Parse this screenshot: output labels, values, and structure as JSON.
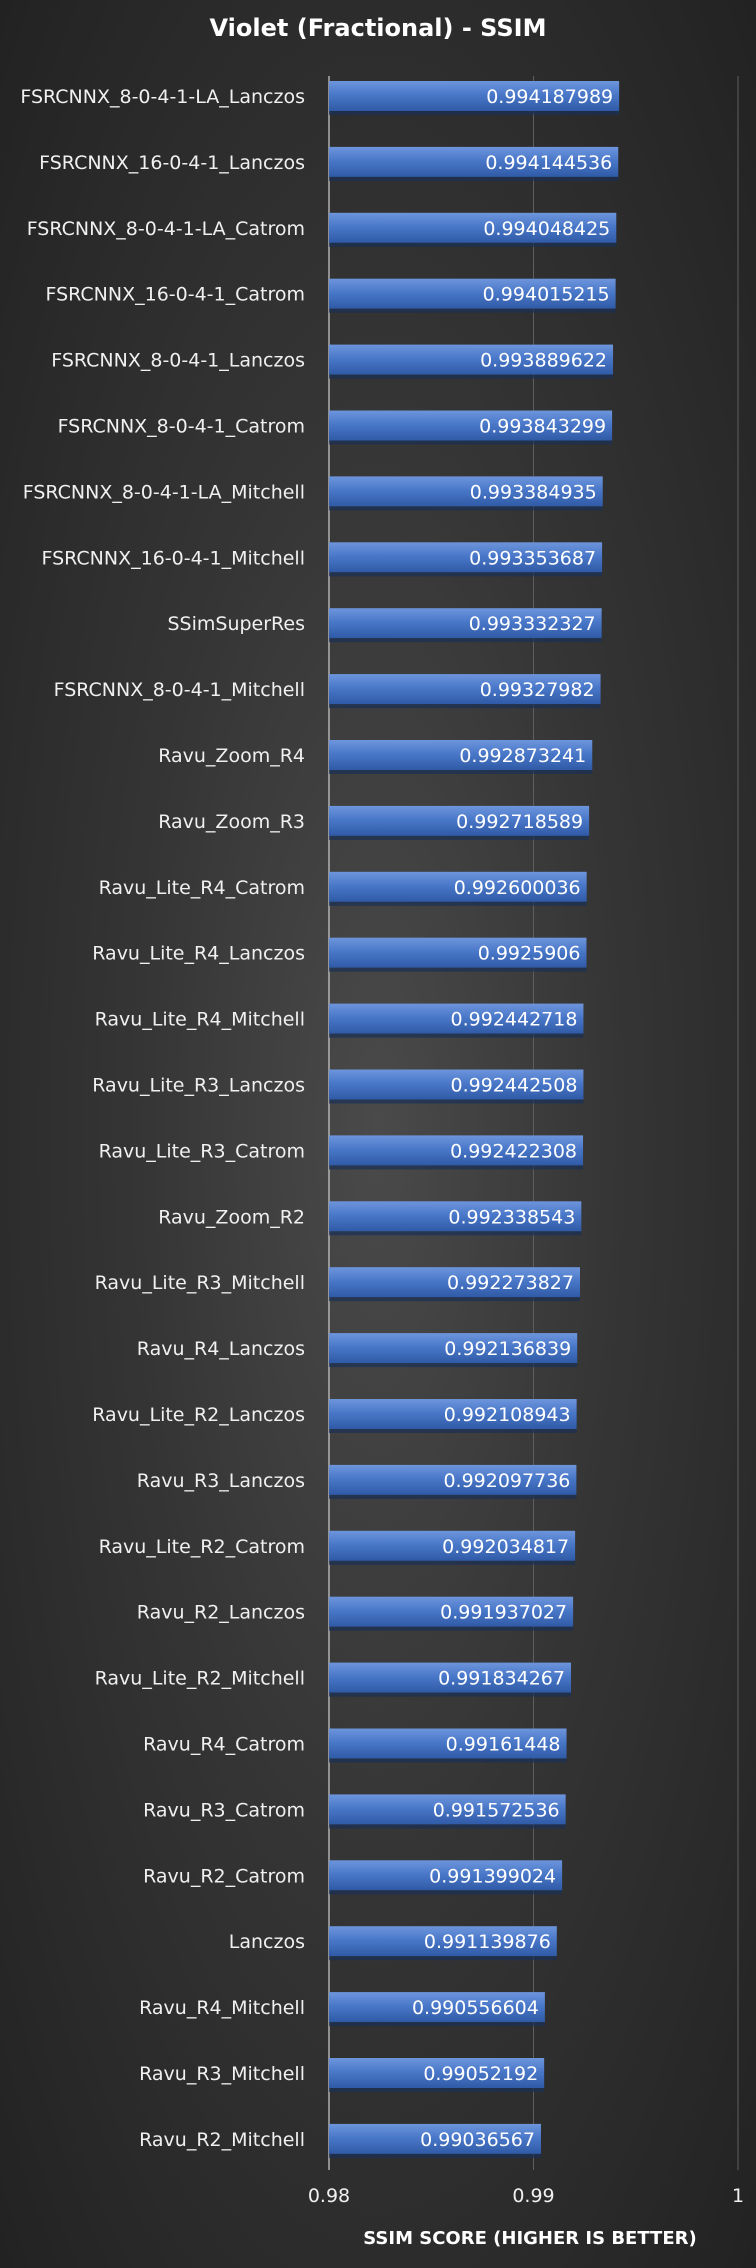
{
  "chart_data": {
    "type": "bar",
    "orientation": "horizontal",
    "title": "Violet (Fractional)  - SSIM",
    "xlabel": "SSIM SCORE (HIGHER IS BETTER)",
    "ylabel": "",
    "xlim": [
      0.98,
      1
    ],
    "xticks": [
      "0.98",
      "0.99",
      "1"
    ],
    "grid": true,
    "bar_color": "#4472c4",
    "categories": [
      "FSRCNNX_8-0-4-1-LA_Lanczos",
      "FSRCNNX_16-0-4-1_Lanczos",
      "FSRCNNX_8-0-4-1-LA_Catrom",
      "FSRCNNX_16-0-4-1_Catrom",
      "FSRCNNX_8-0-4-1_Lanczos",
      "FSRCNNX_8-0-4-1_Catrom",
      "FSRCNNX_8-0-4-1-LA_Mitchell",
      "FSRCNNX_16-0-4-1_Mitchell",
      "SSimSuperRes",
      "FSRCNNX_8-0-4-1_Mitchell",
      "Ravu_Zoom_R4",
      "Ravu_Zoom_R3",
      "Ravu_Lite_R4_Catrom",
      "Ravu_Lite_R4_Lanczos",
      "Ravu_Lite_R4_Mitchell",
      "Ravu_Lite_R3_Lanczos",
      "Ravu_Lite_R3_Catrom",
      "Ravu_Zoom_R2",
      "Ravu_Lite_R3_Mitchell",
      "Ravu_R4_Lanczos",
      "Ravu_Lite_R2_Lanczos",
      "Ravu_R3_Lanczos",
      "Ravu_Lite_R2_Catrom",
      "Ravu_R2_Lanczos",
      "Ravu_Lite_R2_Mitchell",
      "Ravu_R4_Catrom",
      "Ravu_R3_Catrom",
      "Ravu_R2_Catrom",
      "Lanczos",
      "Ravu_R4_Mitchell",
      "Ravu_R3_Mitchell",
      "Ravu_R2_Mitchell"
    ],
    "values": [
      0.994187989,
      0.994144536,
      0.994048425,
      0.994015215,
      0.993889622,
      0.993843299,
      0.993384935,
      0.993353687,
      0.993332327,
      0.99327982,
      0.992873241,
      0.992718589,
      0.992600036,
      0.9925906,
      0.992442718,
      0.992442508,
      0.992422308,
      0.992338543,
      0.992273827,
      0.992136839,
      0.992108943,
      0.992097736,
      0.992034817,
      0.991937027,
      0.991834267,
      0.99161448,
      0.991572536,
      0.991399024,
      0.991139876,
      0.990556604,
      0.99052192,
      0.99036567
    ],
    "value_labels": [
      "0.994187989",
      "0.994144536",
      "0.994048425",
      "0.994015215",
      "0.993889622",
      "0.993843299",
      "0.993384935",
      "0.993353687",
      "0.993332327",
      "0.99327982",
      "0.992873241",
      "0.992718589",
      "0.992600036",
      "0.9925906",
      "0.992442718",
      "0.992442508",
      "0.992422308",
      "0.992338543",
      "0.992273827",
      "0.992136839",
      "0.992108943",
      "0.992097736",
      "0.992034817",
      "0.991937027",
      "0.991834267",
      "0.99161448",
      "0.991572536",
      "0.991399024",
      "0.991139876",
      "0.990556604",
      "0.99052192",
      "0.99036567"
    ]
  }
}
